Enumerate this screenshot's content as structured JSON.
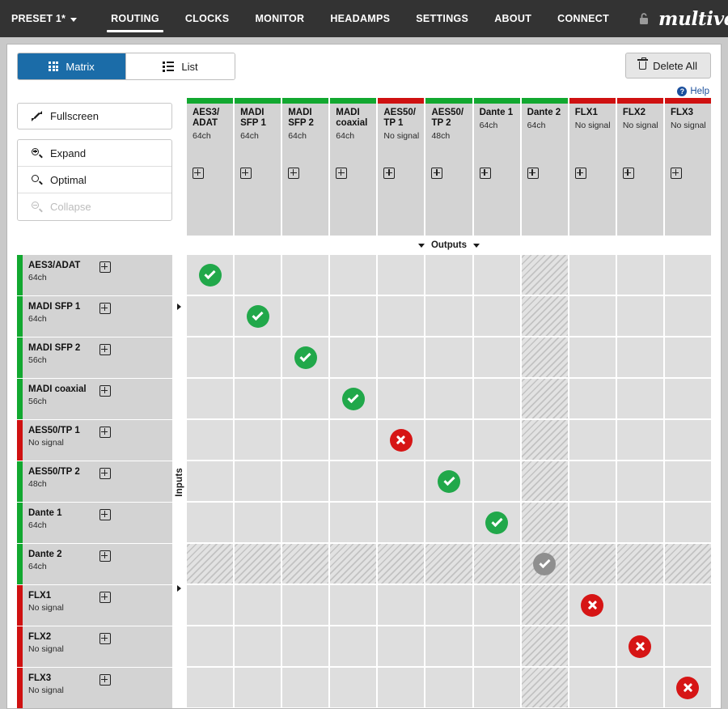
{
  "navbar": {
    "preset": "PRESET 1*",
    "items": [
      {
        "label": "ROUTING",
        "active": true
      },
      {
        "label": "CLOCKS",
        "active": false
      },
      {
        "label": "MONITOR",
        "active": false
      },
      {
        "label": "HEADAMPS",
        "active": false
      },
      {
        "label": "SETTINGS",
        "active": false
      },
      {
        "label": "ABOUT",
        "active": false
      },
      {
        "label": "CONNECT",
        "active": false
      }
    ],
    "lock_icon": "unlocked-padlock-icon",
    "brand": "multiverter"
  },
  "toolbar": {
    "matrix_label": "Matrix",
    "list_label": "List",
    "delete_all_label": "Delete All"
  },
  "help": {
    "label": "Help",
    "icon": "question-circle-icon"
  },
  "tools": {
    "fullscreen": "Fullscreen",
    "expand": "Expand",
    "optimal": "Optimal",
    "collapse": "Collapse"
  },
  "axes": {
    "outputs_label": "Outputs",
    "inputs_label": "Inputs"
  },
  "colors": {
    "accent_blue": "#1b6ca8",
    "status_ok": "#12a830",
    "status_err": "#cf1111",
    "badge_ok": "#21a84a",
    "badge_err": "#d61515",
    "badge_dim": "#8f8f8f",
    "navbar_bg": "#333333",
    "header_bg": "#d3d3d3",
    "cell_bg": "#dedede",
    "help_blue": "#1b4f9c"
  },
  "columns": [
    {
      "name": "AES3/ ADAT",
      "status": "64ch",
      "state": "ok"
    },
    {
      "name": "MADI SFP 1",
      "status": "64ch",
      "state": "ok"
    },
    {
      "name": "MADI SFP 2",
      "status": "64ch",
      "state": "ok"
    },
    {
      "name": "MADI coaxial",
      "status": "64ch",
      "state": "ok"
    },
    {
      "name": "AES50/ TP 1",
      "status": "No signal",
      "state": "err"
    },
    {
      "name": "AES50/ TP 2",
      "status": "48ch",
      "state": "ok"
    },
    {
      "name": "Dante 1",
      "status": "64ch",
      "state": "ok"
    },
    {
      "name": "Dante 2",
      "status": "64ch",
      "state": "ok"
    },
    {
      "name": "FLX1",
      "status": "No signal",
      "state": "err"
    },
    {
      "name": "FLX2",
      "status": "No signal",
      "state": "err"
    },
    {
      "name": "FLX3",
      "status": "No signal",
      "state": "err"
    }
  ],
  "rows": [
    {
      "name": "AES3/ADAT",
      "status": "64ch",
      "state": "ok"
    },
    {
      "name": "MADI SFP 1",
      "status": "64ch",
      "state": "ok"
    },
    {
      "name": "MADI SFP 2",
      "status": "56ch",
      "state": "ok"
    },
    {
      "name": "MADI coaxial",
      "status": "56ch",
      "state": "ok"
    },
    {
      "name": "AES50/TP 1",
      "status": "No signal",
      "state": "err"
    },
    {
      "name": "AES50/TP 2",
      "status": "48ch",
      "state": "ok"
    },
    {
      "name": "Dante 1",
      "status": "64ch",
      "state": "ok"
    },
    {
      "name": "Dante 2",
      "status": "64ch",
      "state": "ok"
    },
    {
      "name": "FLX1",
      "status": "No signal",
      "state": "err"
    },
    {
      "name": "FLX2",
      "status": "No signal",
      "state": "err"
    },
    {
      "name": "FLX3",
      "status": "No signal",
      "state": "err"
    }
  ],
  "matrix": [
    [
      "ok",
      "",
      "",
      "",
      "",
      "",
      "",
      "hatch",
      "",
      "",
      ""
    ],
    [
      "",
      "ok",
      "",
      "",
      "",
      "",
      "",
      "hatch",
      "",
      "",
      ""
    ],
    [
      "",
      "",
      "ok",
      "",
      "",
      "",
      "",
      "hatch",
      "",
      "",
      ""
    ],
    [
      "",
      "",
      "",
      "ok",
      "",
      "",
      "",
      "hatch",
      "",
      "",
      ""
    ],
    [
      "",
      "",
      "",
      "",
      "err",
      "",
      "",
      "hatch",
      "",
      "",
      ""
    ],
    [
      "",
      "",
      "",
      "",
      "",
      "ok",
      "",
      "hatch",
      "",
      "",
      ""
    ],
    [
      "",
      "",
      "",
      "",
      "",
      "",
      "ok",
      "hatch",
      "",
      "",
      ""
    ],
    [
      "hatch",
      "hatch",
      "hatch",
      "hatch",
      "hatch",
      "hatch",
      "hatch",
      "hatch-dim",
      "hatch",
      "hatch",
      "hatch"
    ],
    [
      "",
      "",
      "",
      "",
      "",
      "",
      "",
      "hatch",
      "err",
      "",
      ""
    ],
    [
      "",
      "",
      "",
      "",
      "",
      "",
      "",
      "hatch",
      "",
      "err",
      ""
    ],
    [
      "",
      "",
      "",
      "",
      "",
      "",
      "",
      "hatch",
      "",
      "",
      "err"
    ]
  ]
}
